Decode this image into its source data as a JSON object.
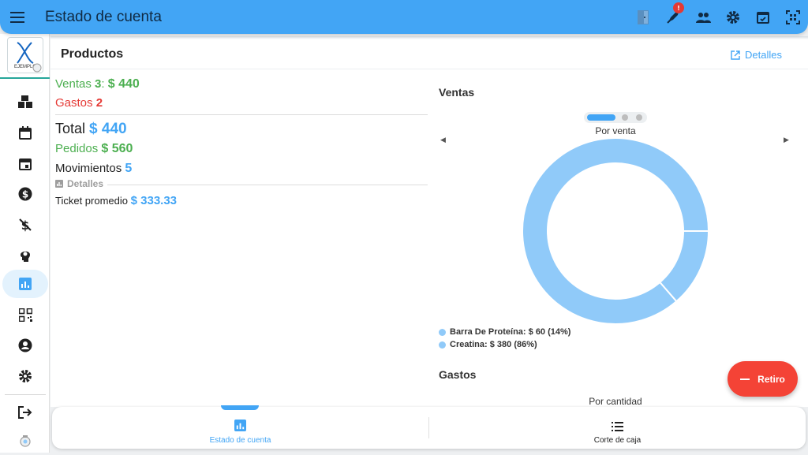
{
  "header": {
    "title": "Estado de cuenta",
    "notification_count": "!",
    "icons": [
      "menu-icon",
      "door-icon",
      "rocket-icon",
      "people-icon",
      "settings-icon",
      "calendar-check-icon",
      "qr-scan-icon"
    ]
  },
  "sidebar": {
    "logo_text": "EJEMPLO",
    "items": [
      "boxes-icon",
      "calendar-icon",
      "calendar-event-icon",
      "dollar-icon",
      "money-off-icon",
      "head-icon",
      "chart-icon",
      "qr-icon",
      "account-icon",
      "settings-icon",
      "logout-icon",
      "logo-small-icon"
    ],
    "active_item": "chart-icon"
  },
  "card": {
    "title": "Productos",
    "details_link": "Detalles"
  },
  "stats": {
    "ventas_label": "Ventas",
    "ventas_count": "3",
    "ventas_sep": ":",
    "ventas_amount": "$ 440",
    "gastos_label": "Gastos",
    "gastos_count": "2",
    "total_label": "Total",
    "total_amount": "$ 440",
    "pedidos_label": "Pedidos",
    "pedidos_amount": "$ 560",
    "movimientos_label": "Movimientos",
    "movimientos_count": "5",
    "details_label": "Detalles",
    "ticket_label": "Ticket promedio",
    "ticket_amount": "$ 333.33"
  },
  "ventas_section": {
    "title": "Ventas",
    "subtitle": "Por venta",
    "carousel_active": 1,
    "carousel_count": 3
  },
  "gastos_section": {
    "title": "Gastos",
    "subtitle": "Por cantidad"
  },
  "chart_data": {
    "type": "pie",
    "donut": true,
    "title": "Por venta",
    "categories": [
      "Barra De Proteína",
      "Creatina"
    ],
    "values": [
      60,
      380
    ],
    "percentages": [
      14,
      86
    ],
    "legend": [
      "Barra De Proteína: $ 60 (14%)",
      "Creatina: $ 380 (86%)"
    ],
    "colors": [
      "#90caf9",
      "#90caf9"
    ],
    "legend_position": "bottom-left"
  },
  "fab": {
    "label": "Retiro"
  },
  "bottom_nav": {
    "items": [
      {
        "label": "Estado de cuenta",
        "icon": "chart-icon",
        "active": true
      },
      {
        "label": "Corte de caja",
        "icon": "list-icon",
        "active": false
      }
    ]
  },
  "colors": {
    "primary": "#42a5f5",
    "green": "#4caf50",
    "red": "#e53935",
    "fab": "#f44336",
    "slice": "#90caf9"
  }
}
